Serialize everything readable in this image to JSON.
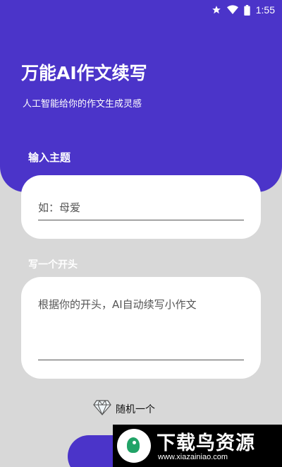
{
  "status_bar": {
    "time": "1:55"
  },
  "header": {
    "title": "万能AI作文续写",
    "subtitle": "人工智能给你的作文生成灵感"
  },
  "topic": {
    "label": "输入主题",
    "placeholder": "如：母爱",
    "value": ""
  },
  "opening": {
    "label": "写一个开头",
    "placeholder": "根据你的开头，AI自动续写小作文",
    "value": ""
  },
  "random_button": {
    "label": "随机一个"
  },
  "watermark": {
    "title": "下载鸟资源",
    "url": "www.xiazainiao.com"
  },
  "colors": {
    "primary": "#4b34c9",
    "background": "#d8d8d8",
    "card": "#ffffff"
  }
}
